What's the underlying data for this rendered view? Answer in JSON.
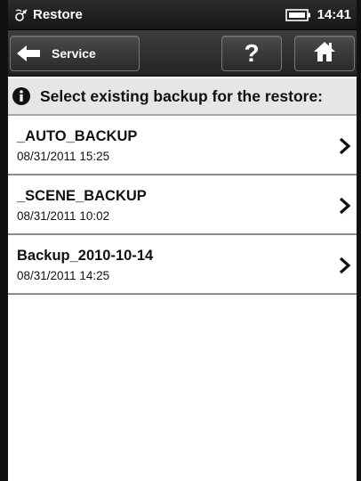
{
  "status": {
    "app_icon": "satellite-icon",
    "title": "Restore",
    "battery_icon": "battery-icon",
    "time": "14:41"
  },
  "toolbar": {
    "back_label": "Service",
    "back_icon": "back-arrow-icon",
    "help_label": "?",
    "home_icon": "home-icon"
  },
  "info": {
    "icon": "info-icon",
    "text": "Select existing backup for the restore:"
  },
  "backups": [
    {
      "name": "_AUTO_BACKUP",
      "date": "08/31/2011 15:25"
    },
    {
      "name": "_SCENE_BACKUP",
      "date": "08/31/2011 10:02"
    },
    {
      "name": "Backup_2010-10-14",
      "date": "08/31/2011 14:25"
    }
  ],
  "colors": {
    "statusbar": "#1e1e1e",
    "toolbar": "#2e2e2e",
    "infobar": "#e6e6e6",
    "text": "#111111"
  }
}
